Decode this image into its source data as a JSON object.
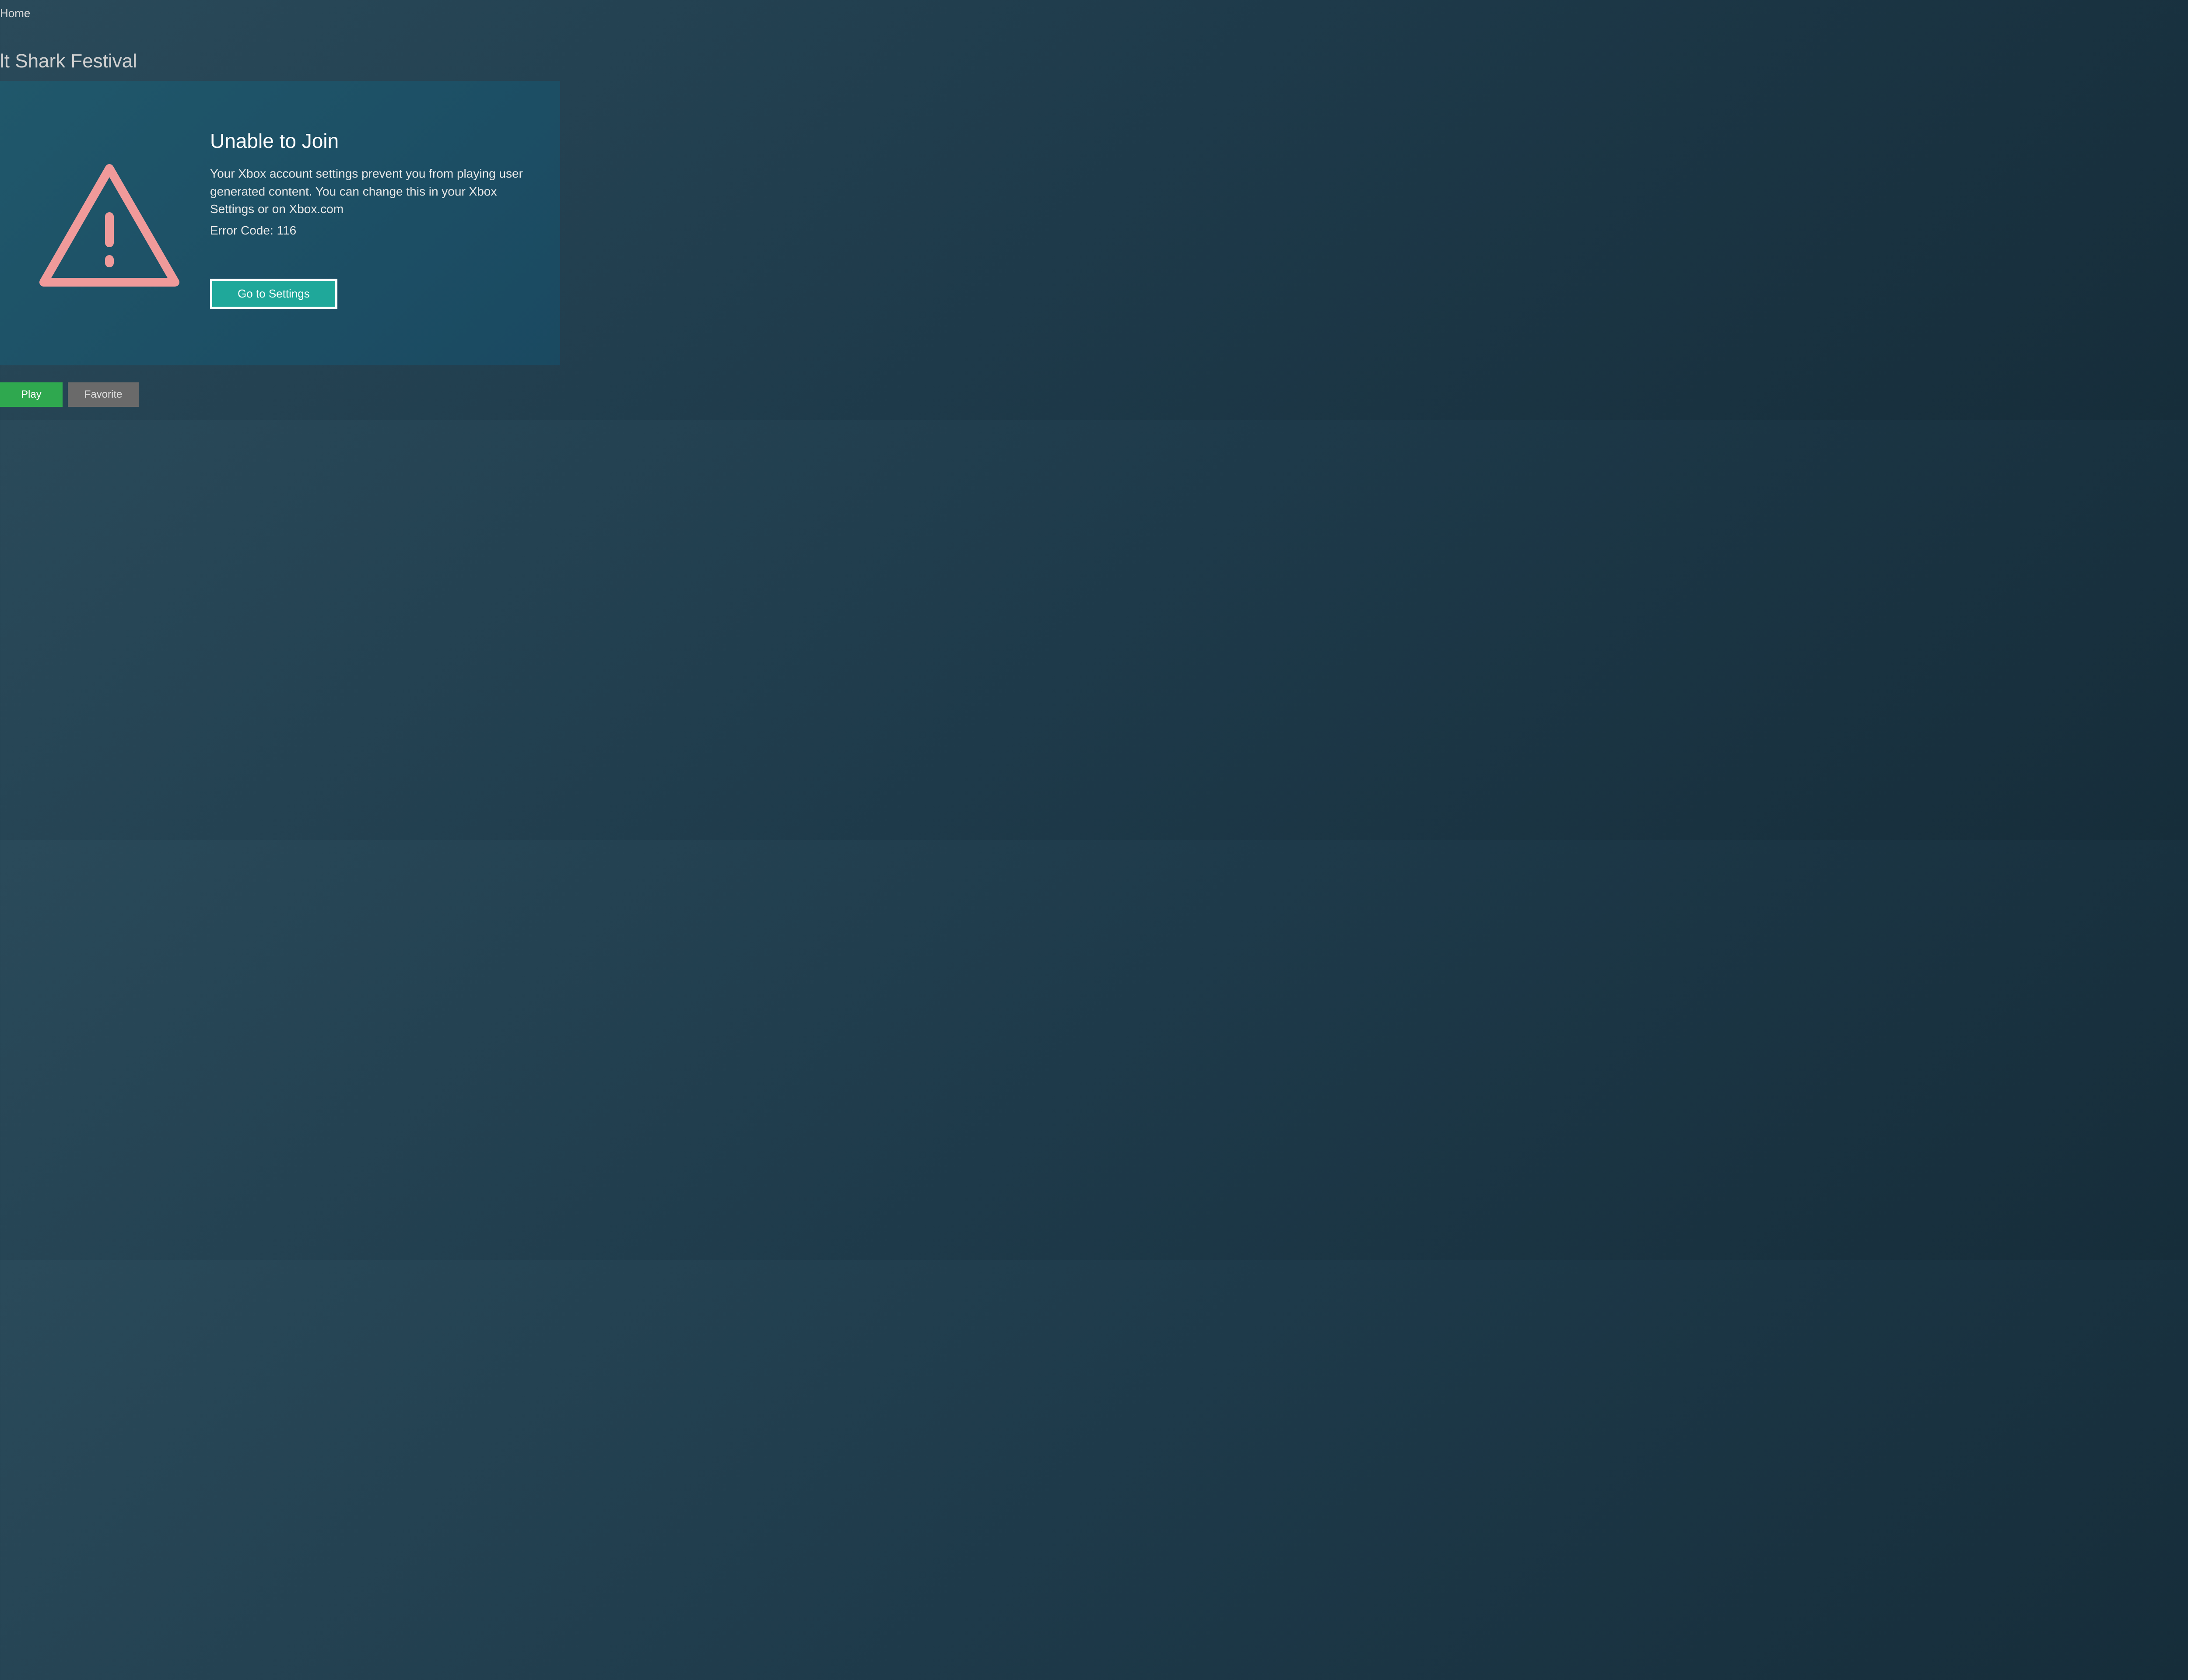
{
  "header": {
    "home_label": "Home",
    "game_title": "lt Shark Festival"
  },
  "error_dialog": {
    "title": "Unable to Join",
    "message": "Your Xbox account settings prevent you from playing user generated content. You can change this in your Xbox Settings or on Xbox.com",
    "error_code_label": "Error Code: 116",
    "action_button_label": "Go to Settings",
    "icon_name": "warning-triangle"
  },
  "bottom_actions": {
    "play_label": "Play",
    "favorite_label": "Favorite"
  },
  "colors": {
    "warning_icon": "#f09a9a",
    "primary_button": "#1fa89a",
    "play_button": "#2fa84f",
    "favorite_button": "#6a6a6a"
  }
}
